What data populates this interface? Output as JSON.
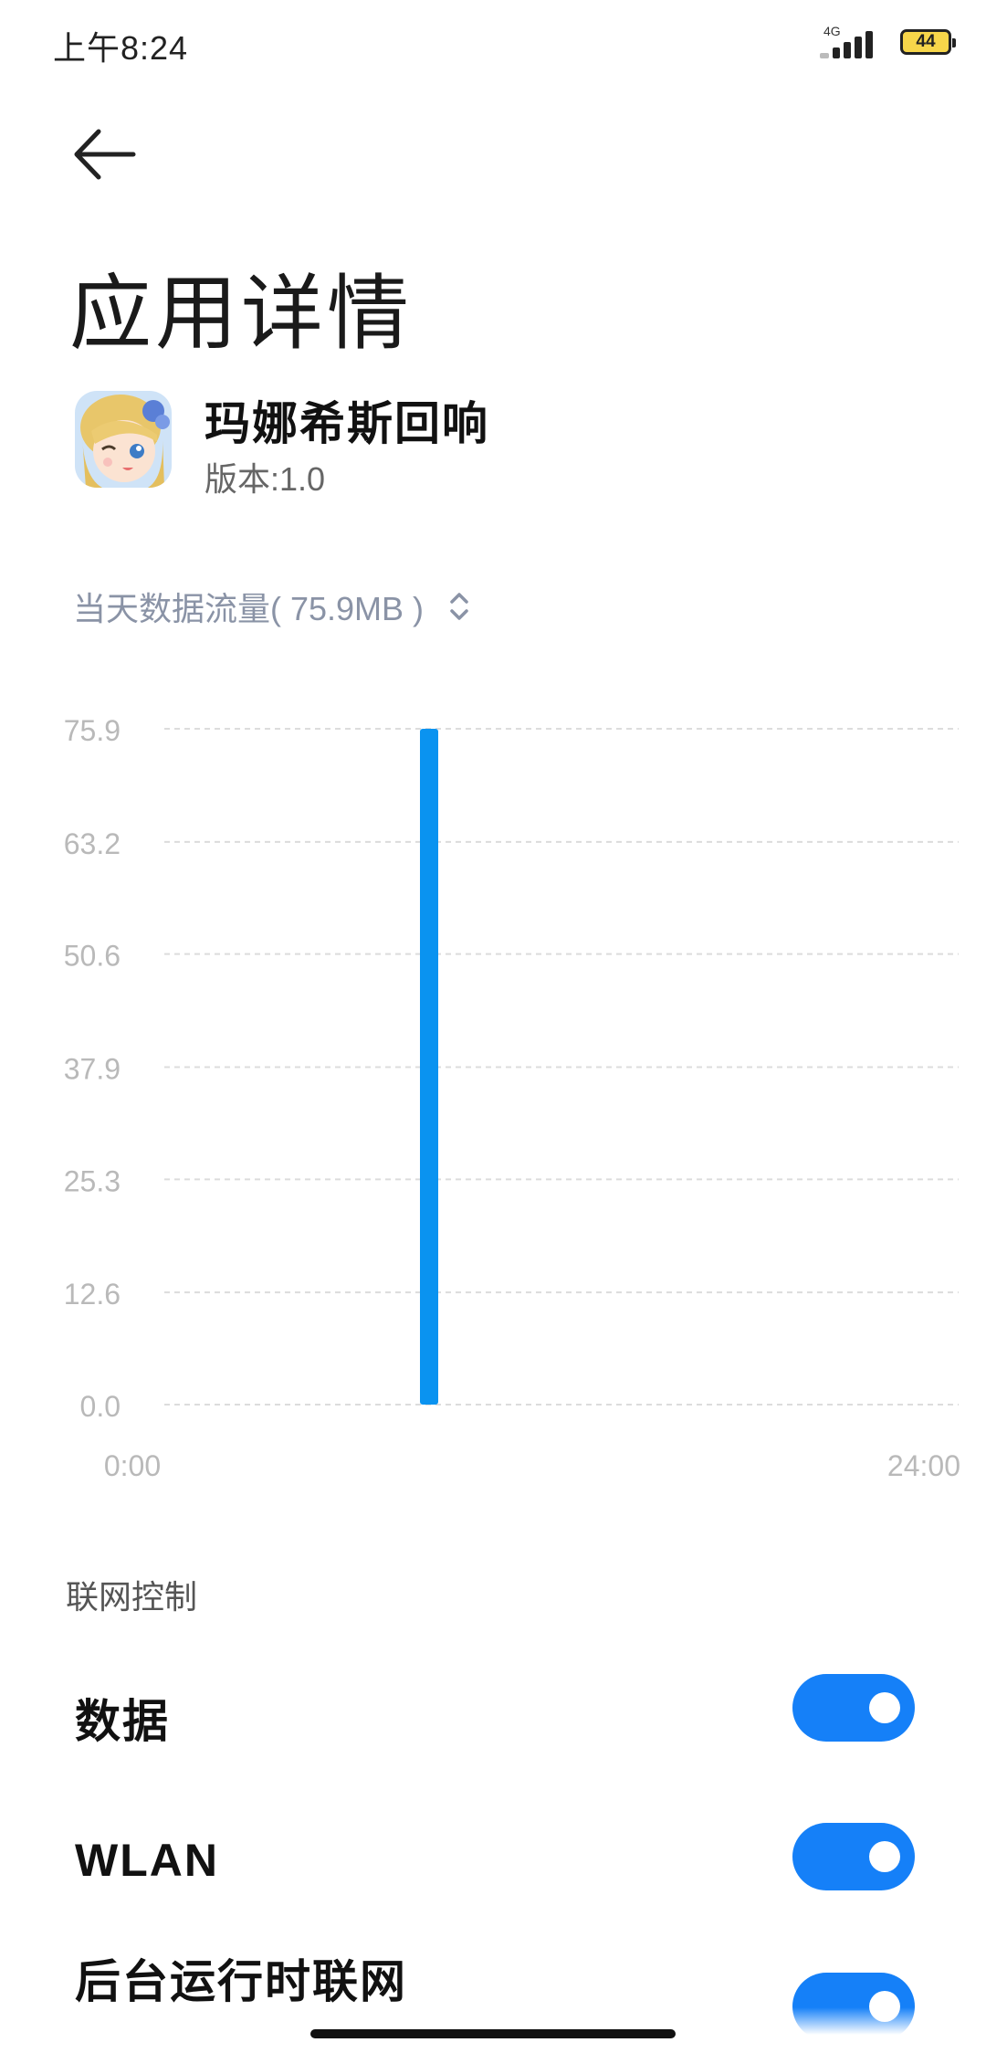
{
  "status_bar": {
    "time": "上午8:24",
    "network_type": "4G",
    "battery_level": "44",
    "battery_color": "#f7d64a"
  },
  "header": {
    "back_icon": "arrow-left-icon",
    "title": "应用详情"
  },
  "app": {
    "name": "玛娜希斯回响",
    "version": "版本:1.0",
    "icon": "anime-girl-app-icon"
  },
  "traffic": {
    "selector_label": "当天数据流量( 75.9MB )",
    "selector_icon": "up-down-chevron-icon"
  },
  "chart_data": {
    "type": "bar",
    "x_start_label": "0:00",
    "x_end_label": "24:00",
    "xlim": [
      0,
      24
    ],
    "ylim": [
      0,
      75.9
    ],
    "y_ticks": [
      "75.9",
      "63.2",
      "50.6",
      "37.9",
      "25.3",
      "12.6",
      "0.0"
    ],
    "y_tick_values": [
      75.9,
      63.2,
      50.6,
      37.9,
      25.3,
      12.6,
      0.0
    ],
    "bar_color": "#0a93f0",
    "grid": true,
    "x": [
      8
    ],
    "values": [
      75.9
    ]
  },
  "network_control": {
    "section_title": "联网控制",
    "toggle_color": "#1580f8",
    "items": [
      {
        "label": "数据",
        "enabled": true
      },
      {
        "label": "WLAN",
        "enabled": true
      },
      {
        "label": "后台运行时联网",
        "enabled": true
      }
    ]
  }
}
